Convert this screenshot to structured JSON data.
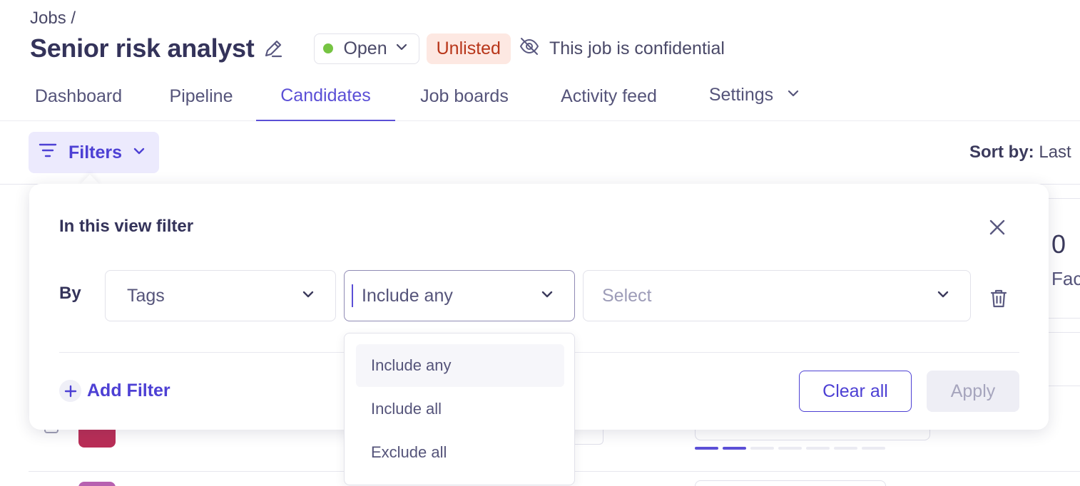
{
  "breadcrumb": "Jobs /",
  "job": {
    "title": "Senior risk analyst",
    "status": "Open",
    "listing_badge": "Unlisted",
    "confidential_text": "This job is confidential"
  },
  "tabs": [
    {
      "label": "Dashboard",
      "active": false
    },
    {
      "label": "Pipeline",
      "active": false
    },
    {
      "label": "Candidates",
      "active": true
    },
    {
      "label": "Job boards",
      "active": false
    },
    {
      "label": "Activity feed",
      "active": false
    },
    {
      "label": "Settings",
      "active": false
    }
  ],
  "toolbar": {
    "filters_label": "Filters",
    "sort_label": "Sort by:",
    "sort_value": "Last"
  },
  "background": {
    "count": "0",
    "stat_label_partial": "Fac"
  },
  "filter_panel": {
    "title": "In this view filter",
    "by_label": "By",
    "field": "Tags",
    "operator": "Include any",
    "value_placeholder": "Select",
    "add_filter_label": "Add Filter",
    "clear_label": "Clear all",
    "apply_label": "Apply"
  },
  "operator_menu": {
    "options": [
      "Include any",
      "Include all",
      "Exclude all"
    ],
    "highlighted": "Include any"
  },
  "colors": {
    "accent": "#5b4fd6",
    "status_open": "#76c442",
    "unlisted_bg": "#fde8e2",
    "unlisted_text": "#b8361a"
  }
}
